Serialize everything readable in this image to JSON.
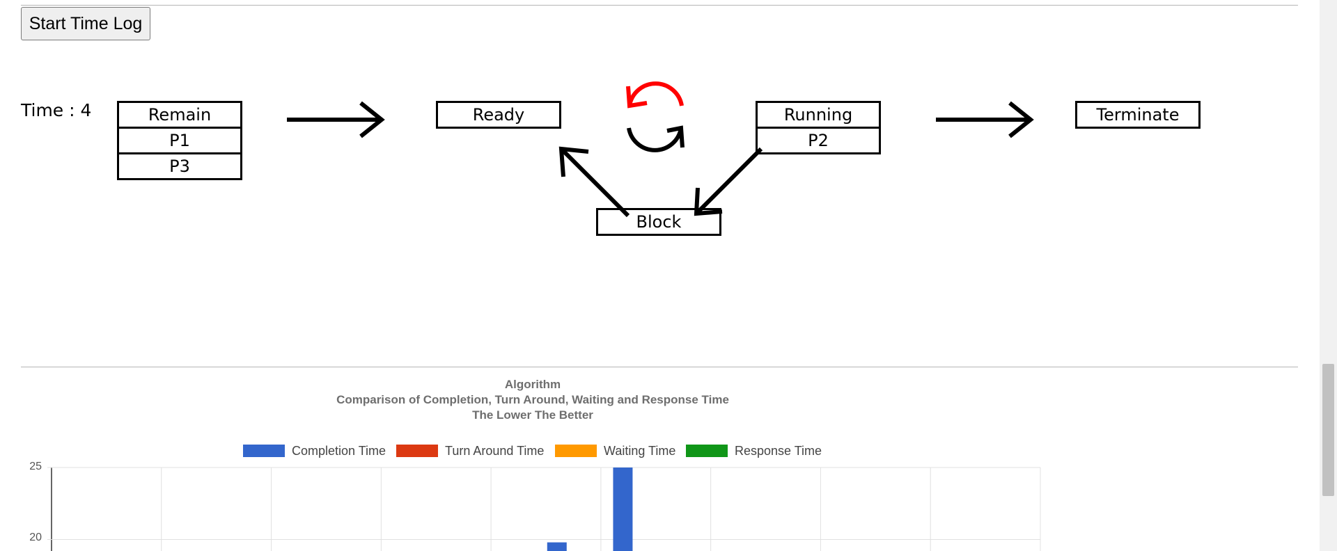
{
  "controls": {
    "start_button_label": "Start Time Log"
  },
  "time": {
    "label": "Time : 4"
  },
  "states": {
    "remain": {
      "title": "Remain",
      "processes": [
        "P1",
        "P3"
      ]
    },
    "ready": {
      "title": "Ready",
      "processes": []
    },
    "running": {
      "title": "Running",
      "processes": [
        "P2"
      ]
    },
    "terminate": {
      "title": "Terminate",
      "processes": []
    },
    "block": {
      "title": "Block",
      "processes": []
    }
  },
  "colors": {
    "cycle_top_arrow": "#ff0000",
    "cycle_bottom_arrow": "#000000"
  },
  "chart": {
    "title_lines": [
      "Algorithm",
      "Comparison of Completion, Turn Around, Waiting and Response Time",
      "The Lower The Better"
    ],
    "legend": [
      {
        "label": "Completion Time",
        "color": "#3366cc"
      },
      {
        "label": "Turn Around Time",
        "color": "#dc3912"
      },
      {
        "label": "Waiting Time",
        "color": "#ff9900"
      },
      {
        "label": "Response Time",
        "color": "#109618"
      }
    ],
    "y_ticks": [
      "25",
      "20"
    ]
  },
  "chart_data": {
    "type": "bar",
    "title": "Algorithm",
    "subtitle": "Comparison of Completion, Turn Around, Waiting and Response Time\nThe Lower The Better",
    "ylim": [
      19.2,
      25
    ],
    "y_ticks": [
      20,
      25
    ],
    "grid": true,
    "legend_position": "top",
    "series": [
      {
        "name": "Completion Time",
        "color": "#3366cc",
        "values": [
          19.8,
          25
        ]
      }
    ],
    "bar_slots": [
      4.6,
      5.2
    ]
  }
}
